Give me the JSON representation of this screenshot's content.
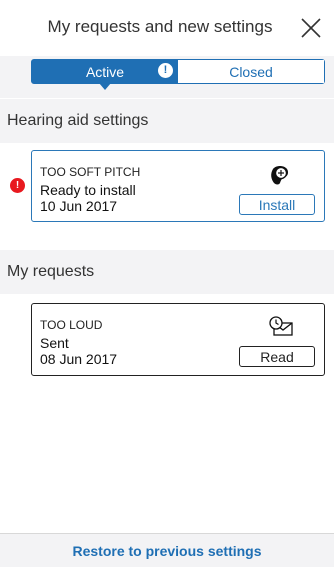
{
  "header": {
    "title": "My requests and new settings"
  },
  "tabs": [
    {
      "label": "Active",
      "active": true
    },
    {
      "label": "Closed",
      "active": false
    }
  ],
  "tab_alert": "!",
  "hearing_section": {
    "title": "Hearing aid settings",
    "alert": "!",
    "card": {
      "title": "TOO SOFT PITCH",
      "status": "Ready to install",
      "date": "10 Jun 2017",
      "button": "Install",
      "icon": "ear-sound-icon"
    }
  },
  "requests_section": {
    "title": "My requests",
    "card": {
      "title": "TOO LOUD",
      "status": "Sent",
      "date": "08 Jun 2017",
      "button": "Read",
      "icon": "envelope-clock-icon"
    }
  },
  "footer": {
    "restore_label": "Restore to previous settings"
  },
  "colors": {
    "accent": "#1f6fb4",
    "alert": "#e8191f",
    "band": "#f3f3f5"
  }
}
